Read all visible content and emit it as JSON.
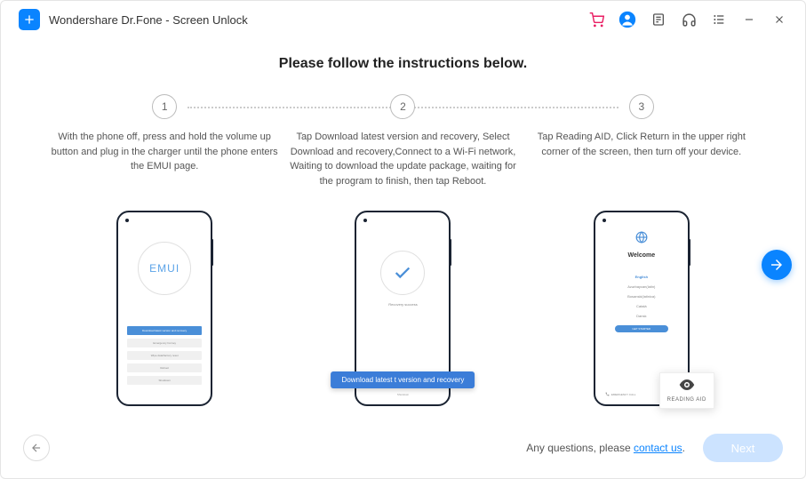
{
  "app": {
    "title": "Wondershare Dr.Fone - Screen Unlock"
  },
  "heading": "Please follow the instructions below.",
  "steps": [
    {
      "num": "1",
      "text": "With the phone off, press and hold the volume up button and plug in the charger until the phone enters the EMUI page."
    },
    {
      "num": "2",
      "text": "Tap Download latest version and recovery, Select Download and recovery,Connect to a Wi-Fi network, Waiting to download the update package, waiting for the program to finish, then tap Reboot."
    },
    {
      "num": "3",
      "text": "Tap Reading AID, Click Return in the upper right corner of the screen, then turn off your device."
    }
  ],
  "phone1": {
    "emui_label": "EMUI",
    "buttons": {
      "primary": "Download latest version and recovery",
      "b1": "Emergency hot key",
      "b2": "Wipe data/factory reset",
      "b3": "Reboot",
      "b4": "Shutdown"
    }
  },
  "phone2": {
    "recovery_text": "Recovery success",
    "tooltip": "Download latest t version and recovery",
    "footer": "Shutdown"
  },
  "phone3": {
    "welcome": "Welcome",
    "langs": {
      "active": "English",
      "l1": "Azərbaycan(latin)",
      "l2": "Bosanski(latinica)",
      "l3": "Català",
      "l4": "Dansk"
    },
    "get_started": "GET STARTED",
    "emergency": "EMERGENCY CALL",
    "reading_aid": "READING AID"
  },
  "footer": {
    "question": "Any questions, please ",
    "contact": "contact us",
    "period": ".",
    "next": "Next"
  }
}
